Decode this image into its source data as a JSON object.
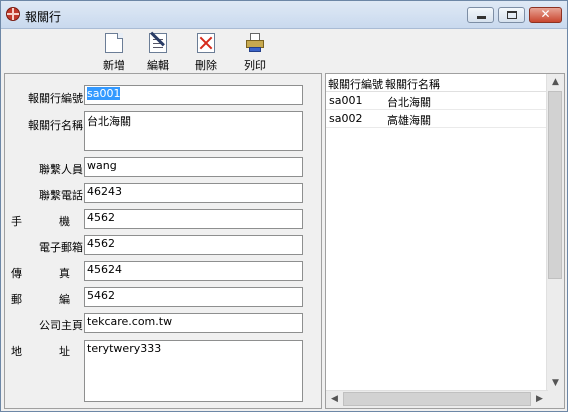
{
  "window": {
    "title": "報關行"
  },
  "toolbar": {
    "buttons": [
      {
        "label": "新增",
        "icon": "new-document-icon"
      },
      {
        "label": "編輯",
        "icon": "edit-icon"
      },
      {
        "label": "刪除",
        "icon": "delete-icon"
      },
      {
        "label": "列印",
        "icon": "print-icon"
      }
    ]
  },
  "form": {
    "fields": [
      {
        "label": "報關行編號",
        "value": "sa001"
      },
      {
        "label": "報關行名稱",
        "value": "台北海關"
      },
      {
        "label": "聯繫人員",
        "value": "wang"
      },
      {
        "label": "聯繫電話",
        "value": "46243"
      },
      {
        "label": "手　機",
        "value": "4562"
      },
      {
        "label": "電子郵箱",
        "value": "4562"
      },
      {
        "label": "傳　真",
        "value": "45624"
      },
      {
        "label": "郵　編",
        "value": "5462"
      },
      {
        "label": "公司主頁",
        "value": "tekcare.com.tw"
      },
      {
        "label": "地　址",
        "value": "terytwery333"
      }
    ]
  },
  "list": {
    "columns": [
      "報關行編號",
      "報關行名稱"
    ],
    "rows": [
      [
        "sa001",
        "台北海關"
      ],
      [
        "sa002",
        "高雄海關"
      ]
    ]
  },
  "colors": {
    "selection": "#3399ff",
    "title_bar": "#dfe9f5",
    "close_button": "#c9462f"
  }
}
